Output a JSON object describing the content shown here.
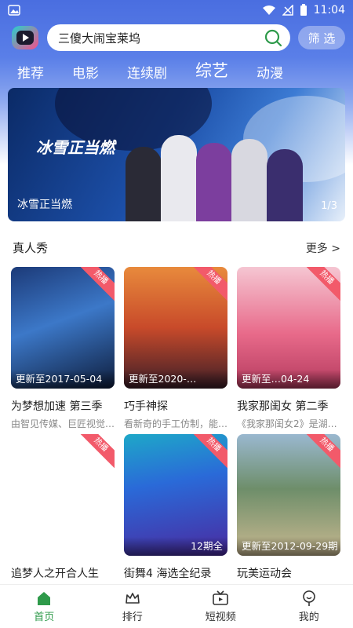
{
  "status_bar": {
    "time": "11:04"
  },
  "search": {
    "query": "三傻大闹宝莱坞",
    "filter_label": "筛 选"
  },
  "tabs": [
    "推荐",
    "电影",
    "连续剧",
    "综艺",
    "动漫"
  ],
  "active_tab": "综艺",
  "banner": {
    "caption": "冰雪正当燃",
    "counter": "1/3",
    "logo_text": "冰雪正当燃"
  },
  "sections": [
    {
      "title": "真人秀",
      "more": "更多 >",
      "items": [
        {
          "badge": "热播",
          "note": "更新至2017-05-04",
          "title": "为梦想加速 第三季",
          "desc": "由智见传媒、巨匠视觉…"
        },
        {
          "badge": "热播",
          "note": "更新至2020-…",
          "title": "巧手神探",
          "desc": "看新奇的手工仿制，能…"
        },
        {
          "badge": "热播",
          "note": "更新至…04-24",
          "title": "我家那闺女 第二季",
          "desc": "《我家那闺女2》是湖…"
        }
      ]
    },
    {
      "items": [
        {
          "badge": "热播",
          "note": "",
          "title": "追梦人之开合人生",
          "desc": ""
        },
        {
          "badge": "热播",
          "note": "12期全",
          "title": "街舞4 海选全纪录",
          "desc": ""
        },
        {
          "badge": "热播",
          "note": "更新至2012-09-29期",
          "title": "玩美运动会",
          "desc": ""
        }
      ]
    }
  ],
  "bottom_nav": [
    {
      "label": "首页",
      "icon": "home-icon",
      "active": true
    },
    {
      "label": "排行",
      "icon": "crown-icon",
      "active": false
    },
    {
      "label": "短视频",
      "icon": "tv-icon",
      "active": false
    },
    {
      "label": "我的",
      "icon": "user-icon",
      "active": false
    }
  ],
  "colors": {
    "accent": "#2e9a4a",
    "hot_badge": "#f25a6a",
    "header_blue": "#4a6ee0"
  }
}
